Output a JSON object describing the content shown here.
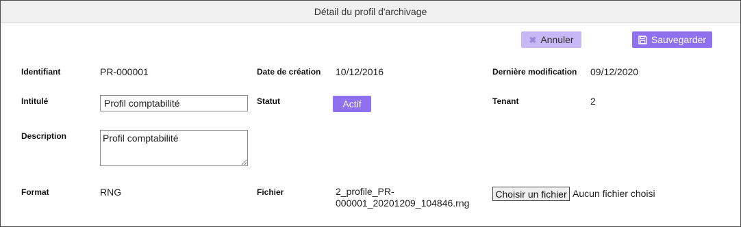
{
  "title": "Détail du profil d'archivage",
  "actions": {
    "cancel_label": "Annuler",
    "save_label": "Sauvegarder"
  },
  "icons": {
    "cancel": "x-icon",
    "save": "floppy-disk-icon"
  },
  "colors": {
    "accent": "#8f70ee",
    "accent_light": "#c8b8f6"
  },
  "fields": {
    "identifiant": {
      "label": "Identifiant",
      "value": "PR-000001"
    },
    "date_creation": {
      "label": "Date de création",
      "value": "10/12/2016"
    },
    "derniere_modification": {
      "label": "Dernière modification",
      "value": "09/12/2020"
    },
    "intitule": {
      "label": "Intitulé",
      "value": "Profil comptabilité"
    },
    "statut": {
      "label": "Statut",
      "value": "Actif"
    },
    "tenant": {
      "label": "Tenant",
      "value": "2"
    },
    "description": {
      "label": "Description",
      "value": "Profil comptabilité"
    },
    "format": {
      "label": "Format",
      "value": "RNG"
    },
    "fichier": {
      "label": "Fichier",
      "value": "2_profile_PR-000001_20201209_104846.rng",
      "choose_label": "Choisir un fichier",
      "no_file_label": "Aucun fichier choisi"
    }
  }
}
